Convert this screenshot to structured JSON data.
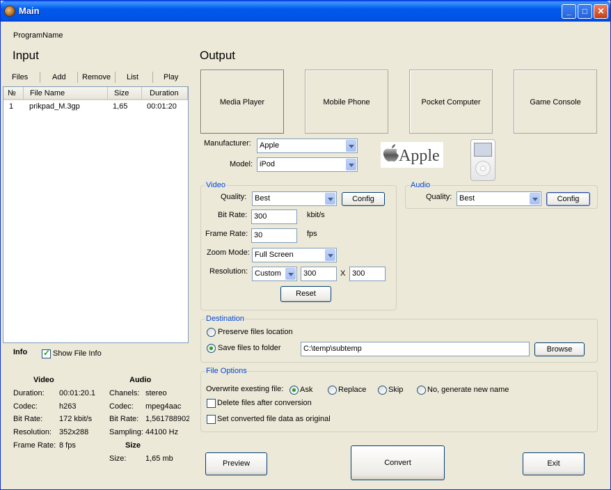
{
  "window": {
    "title": "Main"
  },
  "program_name": "ProgramName",
  "input": {
    "heading": "Input",
    "toolbar": [
      "Files",
      "Add",
      "Remove",
      "List",
      "Play"
    ],
    "columns": [
      "№",
      "File Name",
      "Size",
      "Duration"
    ],
    "rows": [
      {
        "num": "1",
        "name": "prikpad_M.3gp",
        "size": "1,65",
        "duration": "00:01:20"
      }
    ]
  },
  "info": {
    "heading": "Info",
    "show_file_info_label": "Show File Info",
    "show_file_info_checked": true,
    "video": {
      "heading": "Video",
      "fields": [
        {
          "label": "Duration:",
          "value": "00:01:20.1"
        },
        {
          "label": "Codec:",
          "value": "h263"
        },
        {
          "label": "Bit Rate:",
          "value": "172 kbit/s"
        },
        {
          "label": "Resolution:",
          "value": "352x288"
        },
        {
          "label": "Frame Rate:",
          "value": "8 fps"
        }
      ]
    },
    "audio": {
      "heading": "Audio",
      "fields": [
        {
          "label": "Chanels:",
          "value": "stereo"
        },
        {
          "label": "Codec:",
          "value": "mpeg4aac"
        },
        {
          "label": "Bit Rate:",
          "value": "1,561788902"
        },
        {
          "label": "Sampling:",
          "value": "44100 Hz"
        }
      ]
    },
    "size": {
      "heading": "Size",
      "label": "Size:",
      "value": "1,65 mb"
    }
  },
  "output": {
    "heading": "Output",
    "devices": [
      "Media Player",
      "Mobile Phone",
      "Pocket Computer",
      "Game Console"
    ],
    "manufacturer_label": "Manufacturer:",
    "manufacturer_value": "Apple",
    "model_label": "Model:",
    "model_value": "iPod",
    "logo_text": "Apple",
    "video": {
      "title": "Video",
      "quality_label": "Quality:",
      "quality_value": "Best",
      "config_label": "Config",
      "bitrate_label": "Bit Rate:",
      "bitrate_value": "300",
      "bitrate_unit": "kbit/s",
      "framerate_label": "Frame Rate:",
      "framerate_value": "30",
      "framerate_unit": "fps",
      "zoom_label": "Zoom Mode:",
      "zoom_value": "Full Screen",
      "resolution_label": "Resolution:",
      "resolution_mode": "Custom",
      "res_w": "300",
      "res_x": "X",
      "res_h": "300",
      "reset_label": "Reset"
    },
    "audio": {
      "title": "Audio",
      "quality_label": "Quality:",
      "quality_value": "Best",
      "config_label": "Config"
    },
    "destination": {
      "title": "Destination",
      "preserve_label": "Preserve files location",
      "save_label": "Save files to folder",
      "folder_value": "C:\\temp\\subtemp",
      "browse_label": "Browse"
    },
    "file_options": {
      "title": "File Options",
      "overwrite_label": "Overwrite exesting file:",
      "options": [
        "Ask",
        "Replace",
        "Skip",
        "No, generate new name"
      ],
      "selected": "Ask",
      "delete_label": "Delete files after conversion",
      "set_converted_label": "Set converted file data as original"
    }
  },
  "actions": {
    "preview": "Preview",
    "convert": "Convert",
    "exit": "Exit"
  },
  "colors": {
    "titlebar": "#0054E3",
    "group_title": "#0046D5",
    "face": "#ECE9D8"
  }
}
